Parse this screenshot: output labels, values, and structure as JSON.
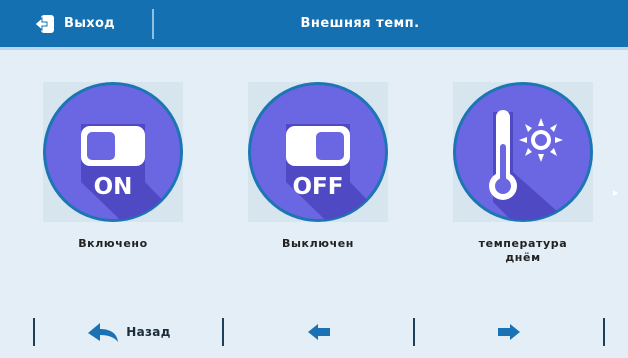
{
  "header": {
    "exit_label": "Выход",
    "title": "Внешняя темп."
  },
  "tiles": [
    {
      "label": "Включено",
      "icon": "toggle-on-icon",
      "text": "ON"
    },
    {
      "label": "Выключен",
      "icon": "toggle-off-icon",
      "text": "OFF"
    },
    {
      "label_line1": "температура",
      "label_line2": "днём",
      "icon": "thermometer-sun-icon"
    }
  ],
  "footer": {
    "back_label": "Назад",
    "prev_icon": "arrow-left-icon",
    "next_icon": "arrow-right-icon"
  },
  "colors": {
    "header": "#1470b0",
    "circle": "#6b66e2",
    "circle_shadow": "#5049c4",
    "arrow": "#1a72b4"
  }
}
